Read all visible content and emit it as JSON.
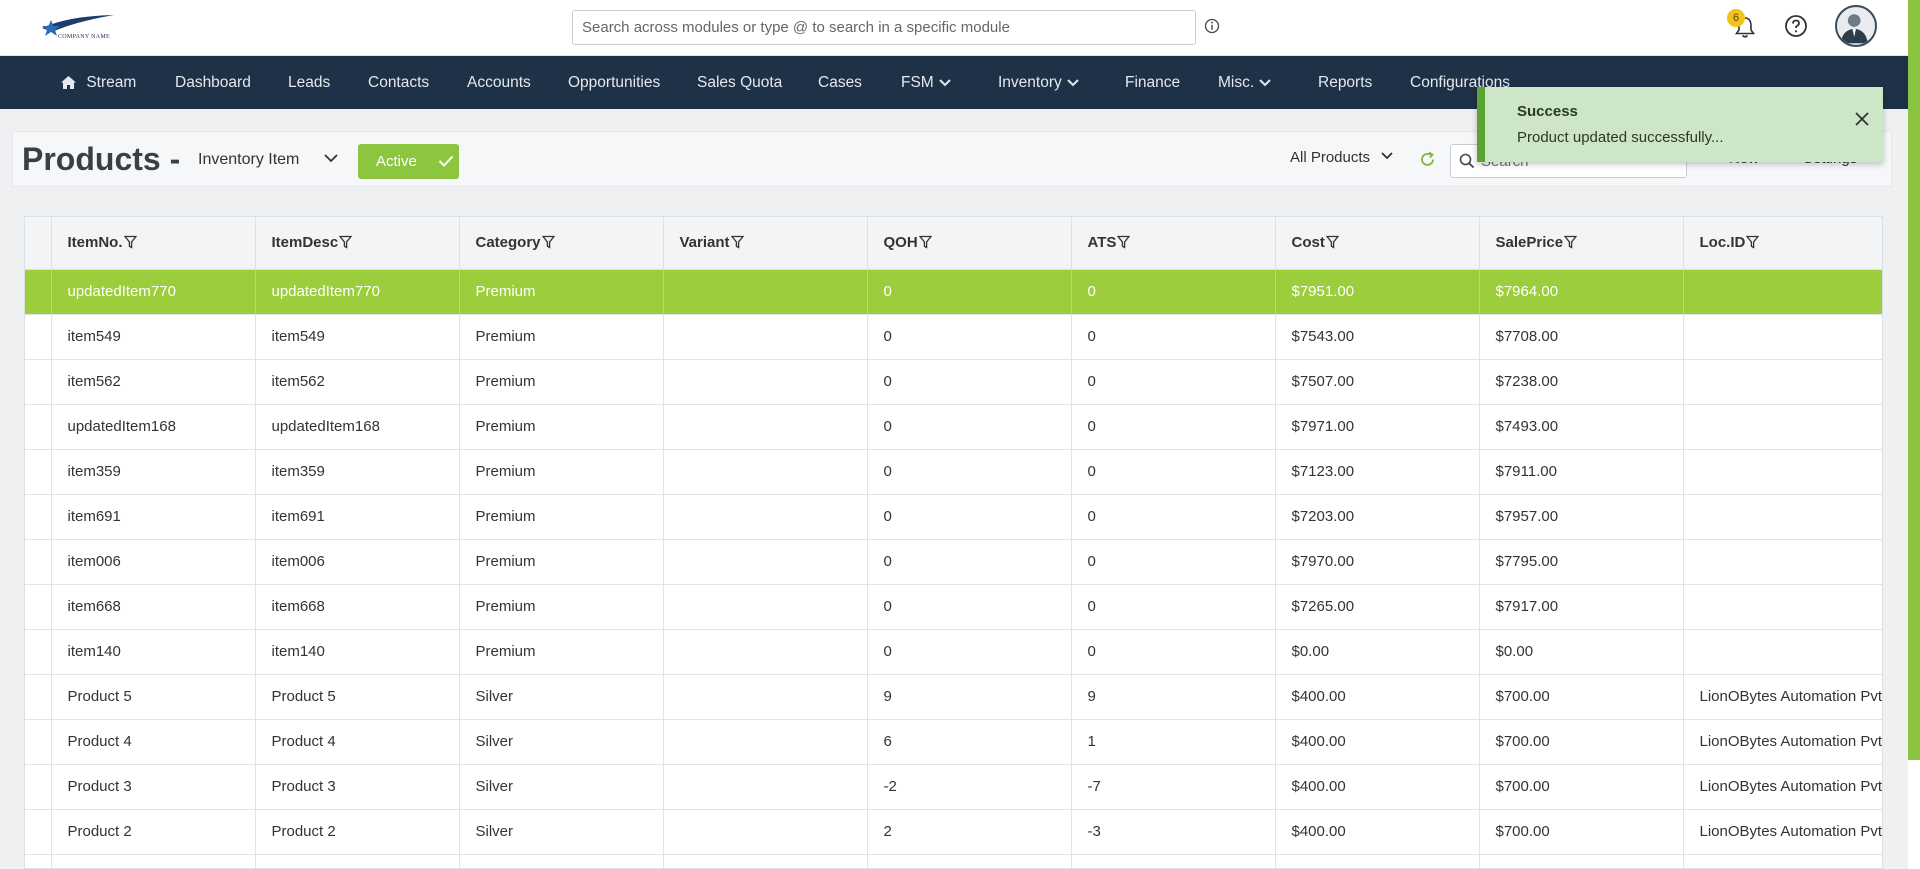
{
  "header": {
    "logo_text": "COMPANY NAME",
    "search_placeholder": "Search across modules or type @ to search in a specific module",
    "notification_count": "6"
  },
  "nav": {
    "items": [
      {
        "label": "Stream",
        "icon": "home-icon"
      },
      {
        "label": "Dashboard"
      },
      {
        "label": "Leads"
      },
      {
        "label": "Contacts"
      },
      {
        "label": "Accounts"
      },
      {
        "label": "Opportunities"
      },
      {
        "label": "Sales Quota"
      },
      {
        "label": "Cases"
      },
      {
        "label": "FSM",
        "dropdown": true
      },
      {
        "label": "Inventory",
        "dropdown": true
      },
      {
        "label": "Finance"
      },
      {
        "label": "Misc.",
        "dropdown": true
      },
      {
        "label": "Reports"
      },
      {
        "label": "Configurations"
      }
    ]
  },
  "page": {
    "title": "Products -",
    "type_select": "Inventory Item",
    "status_button": "Active",
    "filter_select": "All Products",
    "search_placeholder": "Search",
    "new_label": "New",
    "settings_label": "Settings"
  },
  "toast": {
    "title": "Success",
    "message": "Product updated successfully..."
  },
  "table": {
    "columns": [
      "ItemNo.",
      "ItemDesc",
      "Category",
      "Variant",
      "QOH",
      "ATS",
      "Cost",
      "SalePrice",
      "Loc.ID"
    ],
    "rows": [
      [
        "updatedItem770",
        "updatedItem770",
        "Premium",
        "",
        "0",
        "0",
        "$7951.00",
        "$7964.00",
        ""
      ],
      [
        "item549",
        "item549",
        "Premium",
        "",
        "0",
        "0",
        "$7543.00",
        "$7708.00",
        ""
      ],
      [
        "item562",
        "item562",
        "Premium",
        "",
        "0",
        "0",
        "$7507.00",
        "$7238.00",
        ""
      ],
      [
        "updatedItem168",
        "updatedItem168",
        "Premium",
        "",
        "0",
        "0",
        "$7971.00",
        "$7493.00",
        ""
      ],
      [
        "item359",
        "item359",
        "Premium",
        "",
        "0",
        "0",
        "$7123.00",
        "$7911.00",
        ""
      ],
      [
        "item691",
        "item691",
        "Premium",
        "",
        "0",
        "0",
        "$7203.00",
        "$7957.00",
        ""
      ],
      [
        "item006",
        "item006",
        "Premium",
        "",
        "0",
        "0",
        "$7970.00",
        "$7795.00",
        ""
      ],
      [
        "item668",
        "item668",
        "Premium",
        "",
        "0",
        "0",
        "$7265.00",
        "$7917.00",
        ""
      ],
      [
        "item140",
        "item140",
        "Premium",
        "",
        "0",
        "0",
        "$0.00",
        "$0.00",
        ""
      ],
      [
        "Product 5",
        "Product 5",
        "Silver",
        "",
        "9",
        "9",
        "$400.00",
        "$700.00",
        "LionOBytes Automation Pvt."
      ],
      [
        "Product 4",
        "Product 4",
        "Silver",
        "",
        "6",
        "1",
        "$400.00",
        "$700.00",
        "LionOBytes Automation Pvt."
      ],
      [
        "Product 3",
        "Product 3",
        "Silver",
        "",
        "-2",
        "-7",
        "$400.00",
        "$700.00",
        "LionOBytes Automation Pvt."
      ],
      [
        "Product 2",
        "Product 2",
        "Silver",
        "",
        "2",
        "-3",
        "$400.00",
        "$700.00",
        "LionOBytes Automation Pvt."
      ],
      [
        "",
        "",
        "",
        "",
        "",
        "",
        "",
        "",
        ""
      ]
    ]
  },
  "colors": {
    "nav_bg": "#1f3146",
    "accent_green": "#8cc63f",
    "highlight_row": "#9bcd3c",
    "toast_bg": "#cde6c8"
  }
}
